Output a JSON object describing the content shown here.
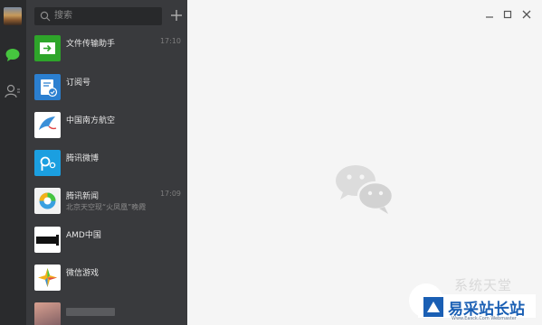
{
  "search": {
    "placeholder": "搜索"
  },
  "conversations": [
    {
      "name": "文件传输助手",
      "time": "17:10",
      "preview": "",
      "icon": "file-transfer-icon"
    },
    {
      "name": "订阅号",
      "time": "",
      "preview": "",
      "icon": "subscription-icon"
    },
    {
      "name": "中国南方航空",
      "time": "",
      "preview": "",
      "icon": "airline-logo-icon"
    },
    {
      "name": "腾讯微博",
      "time": "",
      "preview": "",
      "icon": "weibo-icon"
    },
    {
      "name": "腾讯新闻",
      "time": "17:09",
      "preview": "北京天空现“火凤凰”晚霞",
      "icon": "news-icon"
    },
    {
      "name": "AMD中国",
      "time": "",
      "preview": "",
      "icon": "amd-logo-icon"
    },
    {
      "name": "微信游戏",
      "time": "",
      "preview": "",
      "icon": "game-icon"
    }
  ],
  "watermark": {
    "top": "系统天堂",
    "brand": "易采站长站",
    "url": "Www.Easck.Com Webmaster"
  },
  "colors": {
    "rail": "#2a2b2d",
    "list": "#393a3d",
    "main": "#f5f5f5",
    "accent": "#46c53f"
  }
}
